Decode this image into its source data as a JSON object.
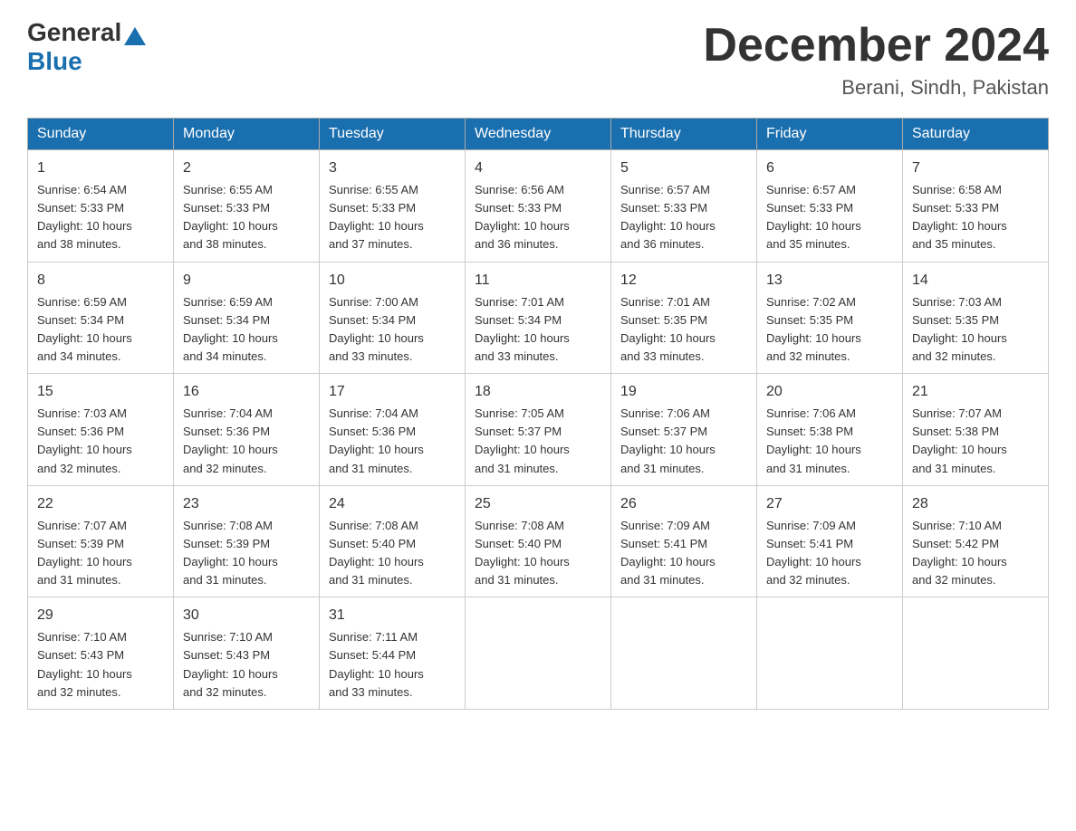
{
  "header": {
    "logo_text_general": "General",
    "logo_text_blue": "Blue",
    "month_title": "December 2024",
    "location": "Berani, Sindh, Pakistan"
  },
  "days_of_week": [
    "Sunday",
    "Monday",
    "Tuesday",
    "Wednesday",
    "Thursday",
    "Friday",
    "Saturday"
  ],
  "weeks": [
    [
      {
        "day": "1",
        "sunrise": "6:54 AM",
        "sunset": "5:33 PM",
        "daylight": "10 hours and 38 minutes."
      },
      {
        "day": "2",
        "sunrise": "6:55 AM",
        "sunset": "5:33 PM",
        "daylight": "10 hours and 38 minutes."
      },
      {
        "day": "3",
        "sunrise": "6:55 AM",
        "sunset": "5:33 PM",
        "daylight": "10 hours and 37 minutes."
      },
      {
        "day": "4",
        "sunrise": "6:56 AM",
        "sunset": "5:33 PM",
        "daylight": "10 hours and 36 minutes."
      },
      {
        "day": "5",
        "sunrise": "6:57 AM",
        "sunset": "5:33 PM",
        "daylight": "10 hours and 36 minutes."
      },
      {
        "day": "6",
        "sunrise": "6:57 AM",
        "sunset": "5:33 PM",
        "daylight": "10 hours and 35 minutes."
      },
      {
        "day": "7",
        "sunrise": "6:58 AM",
        "sunset": "5:33 PM",
        "daylight": "10 hours and 35 minutes."
      }
    ],
    [
      {
        "day": "8",
        "sunrise": "6:59 AM",
        "sunset": "5:34 PM",
        "daylight": "10 hours and 34 minutes."
      },
      {
        "day": "9",
        "sunrise": "6:59 AM",
        "sunset": "5:34 PM",
        "daylight": "10 hours and 34 minutes."
      },
      {
        "day": "10",
        "sunrise": "7:00 AM",
        "sunset": "5:34 PM",
        "daylight": "10 hours and 33 minutes."
      },
      {
        "day": "11",
        "sunrise": "7:01 AM",
        "sunset": "5:34 PM",
        "daylight": "10 hours and 33 minutes."
      },
      {
        "day": "12",
        "sunrise": "7:01 AM",
        "sunset": "5:35 PM",
        "daylight": "10 hours and 33 minutes."
      },
      {
        "day": "13",
        "sunrise": "7:02 AM",
        "sunset": "5:35 PM",
        "daylight": "10 hours and 32 minutes."
      },
      {
        "day": "14",
        "sunrise": "7:03 AM",
        "sunset": "5:35 PM",
        "daylight": "10 hours and 32 minutes."
      }
    ],
    [
      {
        "day": "15",
        "sunrise": "7:03 AM",
        "sunset": "5:36 PM",
        "daylight": "10 hours and 32 minutes."
      },
      {
        "day": "16",
        "sunrise": "7:04 AM",
        "sunset": "5:36 PM",
        "daylight": "10 hours and 32 minutes."
      },
      {
        "day": "17",
        "sunrise": "7:04 AM",
        "sunset": "5:36 PM",
        "daylight": "10 hours and 31 minutes."
      },
      {
        "day": "18",
        "sunrise": "7:05 AM",
        "sunset": "5:37 PM",
        "daylight": "10 hours and 31 minutes."
      },
      {
        "day": "19",
        "sunrise": "7:06 AM",
        "sunset": "5:37 PM",
        "daylight": "10 hours and 31 minutes."
      },
      {
        "day": "20",
        "sunrise": "7:06 AM",
        "sunset": "5:38 PM",
        "daylight": "10 hours and 31 minutes."
      },
      {
        "day": "21",
        "sunrise": "7:07 AM",
        "sunset": "5:38 PM",
        "daylight": "10 hours and 31 minutes."
      }
    ],
    [
      {
        "day": "22",
        "sunrise": "7:07 AM",
        "sunset": "5:39 PM",
        "daylight": "10 hours and 31 minutes."
      },
      {
        "day": "23",
        "sunrise": "7:08 AM",
        "sunset": "5:39 PM",
        "daylight": "10 hours and 31 minutes."
      },
      {
        "day": "24",
        "sunrise": "7:08 AM",
        "sunset": "5:40 PM",
        "daylight": "10 hours and 31 minutes."
      },
      {
        "day": "25",
        "sunrise": "7:08 AM",
        "sunset": "5:40 PM",
        "daylight": "10 hours and 31 minutes."
      },
      {
        "day": "26",
        "sunrise": "7:09 AM",
        "sunset": "5:41 PM",
        "daylight": "10 hours and 31 minutes."
      },
      {
        "day": "27",
        "sunrise": "7:09 AM",
        "sunset": "5:41 PM",
        "daylight": "10 hours and 32 minutes."
      },
      {
        "day": "28",
        "sunrise": "7:10 AM",
        "sunset": "5:42 PM",
        "daylight": "10 hours and 32 minutes."
      }
    ],
    [
      {
        "day": "29",
        "sunrise": "7:10 AM",
        "sunset": "5:43 PM",
        "daylight": "10 hours and 32 minutes."
      },
      {
        "day": "30",
        "sunrise": "7:10 AM",
        "sunset": "5:43 PM",
        "daylight": "10 hours and 32 minutes."
      },
      {
        "day": "31",
        "sunrise": "7:11 AM",
        "sunset": "5:44 PM",
        "daylight": "10 hours and 33 minutes."
      },
      null,
      null,
      null,
      null
    ]
  ],
  "labels": {
    "sunrise": "Sunrise:",
    "sunset": "Sunset:",
    "daylight": "Daylight:"
  }
}
